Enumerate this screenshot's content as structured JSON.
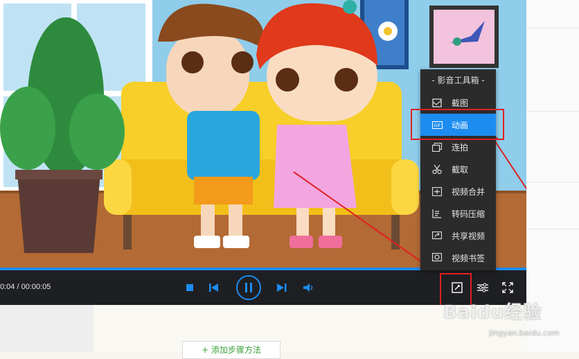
{
  "player": {
    "time": "0:04 / 00:00:05",
    "progress_fraction": 1.0
  },
  "toolbox": {
    "title": "- 影音工具箱 -",
    "items": [
      {
        "label": "截图",
        "icon": "screenshot-icon"
      },
      {
        "label": "动画",
        "icon": "gif-icon",
        "badge": "GIF",
        "active": true
      },
      {
        "label": "连拍",
        "icon": "burst-icon"
      },
      {
        "label": "截取",
        "icon": "scissors-icon"
      },
      {
        "label": "视频合并",
        "icon": "merge-icon"
      },
      {
        "label": "转码压缩",
        "icon": "compress-icon"
      },
      {
        "label": "共享视频",
        "icon": "share-icon"
      },
      {
        "label": "视频书签",
        "icon": "bookmark-icon"
      }
    ]
  },
  "page": {
    "add_step": "+ 添加步骤方法"
  },
  "watermark": {
    "brand": "Baidu经验",
    "url": "jingyan.baidu.com"
  },
  "colors": {
    "accent": "#1d8cf0",
    "highlight": "#e02020",
    "menu_bg": "#2b2b2b",
    "controls_bg": "#1e1f23"
  }
}
